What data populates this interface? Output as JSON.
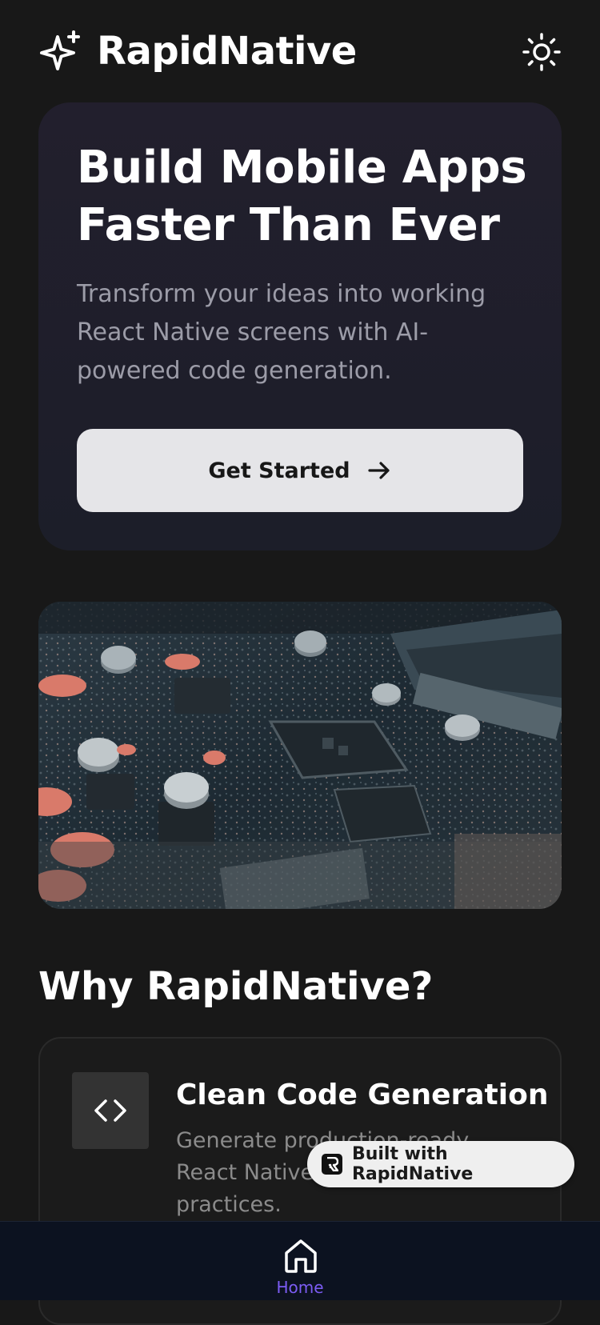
{
  "header": {
    "brand": "RapidNative",
    "logo_icon": "sparkles-icon",
    "theme_toggle_icon": "sun-icon"
  },
  "hero": {
    "title": "Build Mobile Apps Faster Than Ever",
    "subtitle": "Transform your ideas into working React Native screens with AI-powered code generation.",
    "cta_label": "Get Started",
    "cta_icon": "arrow-right-icon"
  },
  "hero_image": {
    "subject": "circuit-board-photo"
  },
  "features": {
    "section_title": "Why RapidNative?",
    "items": [
      {
        "icon": "code-icon",
        "title": "Clean Code Generation",
        "description": "Generate production-ready React Native code with best practices."
      }
    ]
  },
  "badge": {
    "label": "Built with RapidNative"
  },
  "tabbar": {
    "tabs": [
      {
        "label": "Home",
        "icon": "home-icon",
        "active": true
      }
    ]
  },
  "colors": {
    "background": "#181818",
    "hero_card": "#201f2b",
    "accent": "#7c5cf4",
    "cta_bg": "#e5e5e8",
    "tabbar_bg": "#0c1220"
  }
}
